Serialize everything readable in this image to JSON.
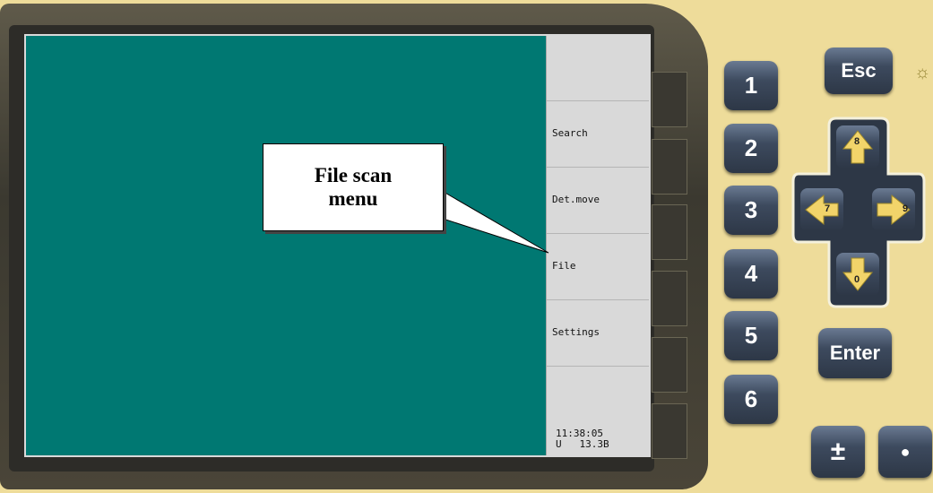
{
  "screen": {
    "softkeys": [
      {
        "label": ""
      },
      {
        "label": "Search"
      },
      {
        "label": "Det.move"
      },
      {
        "label": "File"
      },
      {
        "label": "Settings"
      }
    ],
    "status": {
      "time": "11:38:05",
      "voltage_label": "U",
      "voltage_value": "13.3B"
    }
  },
  "callout": {
    "line1": "File scan",
    "line2": "menu"
  },
  "keypad": {
    "numbers": [
      "1",
      "2",
      "3",
      "4",
      "5",
      "6"
    ],
    "esc": "Esc",
    "enter": "Enter",
    "plus_minus": "±",
    "dot": "●",
    "up": "8",
    "left": "7",
    "right": "9",
    "down": "0"
  },
  "icons": {
    "brightness": "sun-icon"
  }
}
